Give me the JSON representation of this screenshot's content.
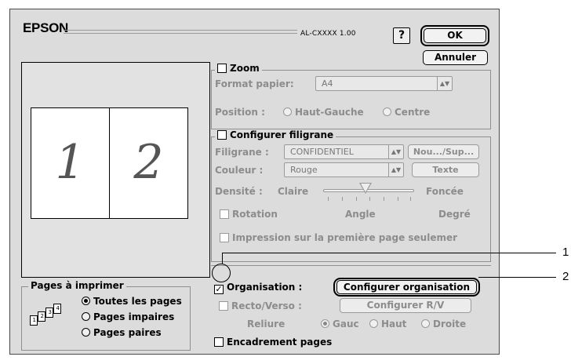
{
  "brand": "EPSON",
  "version": "AL-CXXXX 1.00",
  "help_label": "?",
  "ok_label": "OK",
  "cancel_label": "Annuler",
  "preview": {
    "page1": "1",
    "page2": "2"
  },
  "zoom": {
    "label": "Zoom",
    "paper_label": "Format papier:",
    "paper_value": "A4",
    "position_label": "Position :",
    "position_options": [
      "Haut-Gauche",
      "Centre"
    ]
  },
  "watermark": {
    "label": "Configurer filigrane",
    "filigrane_label": "Filigrane :",
    "filigrane_value": "CONFIDENTIEL",
    "new_del_button": "Nou.../Sup...",
    "color_label": "Couleur :",
    "color_value": "Rouge",
    "text_button": "Texte",
    "density_label": "Densité :",
    "density_min": "Claire",
    "density_max": "Foncée",
    "rotation_label": "Rotation",
    "angle_label": "Angle",
    "degree_label": "Degré",
    "first_page_label": "Impression sur la première page seulemer"
  },
  "layout": {
    "label": "Organisation :",
    "layout_button": "Configurer organisation",
    "duplex_label": "Recto/Verso :",
    "duplex_button": "Configurer R/V",
    "binding_label": "Reliure",
    "binding_options": [
      "Gauc",
      "Haut",
      "Droite"
    ],
    "border_label": "Encadrement pages"
  },
  "pages_to_print": {
    "label": "Pages à imprimer",
    "options": [
      "Toutes les pages",
      "Pages impaires",
      "Pages paires"
    ],
    "icon_pages": [
      "1",
      "2",
      "3",
      "4"
    ]
  },
  "callouts": [
    "1",
    "2"
  ]
}
